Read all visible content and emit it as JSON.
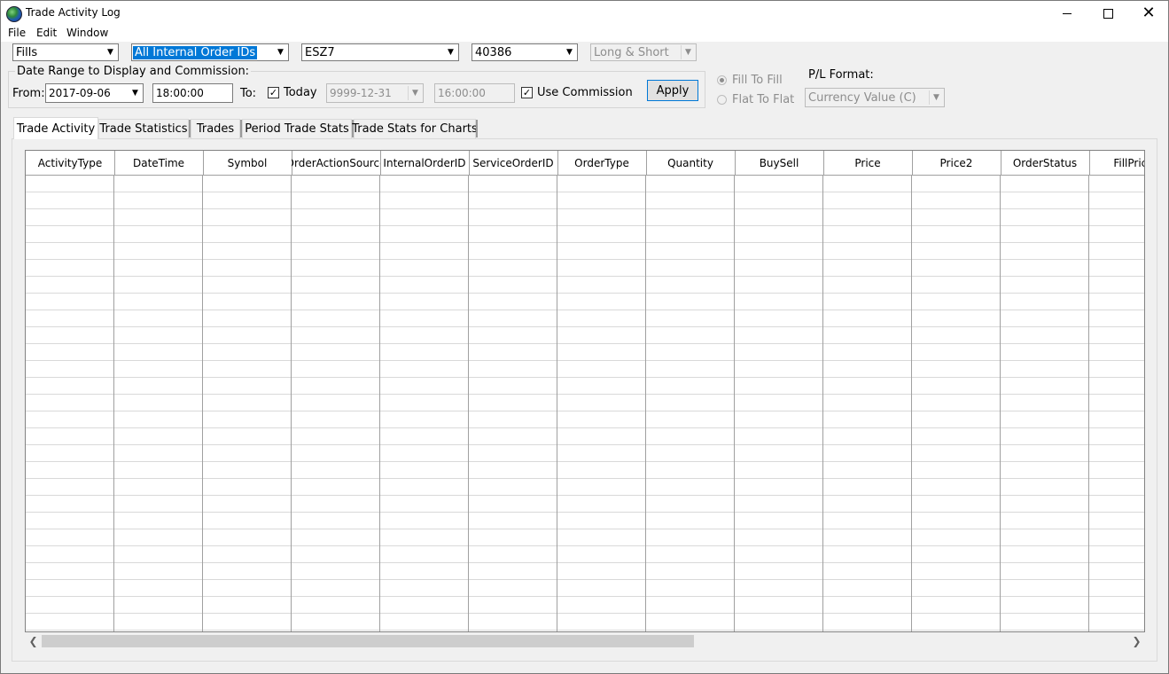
{
  "window": {
    "title": "Trade Activity Log"
  },
  "menu": [
    "File",
    "Edit",
    "Window"
  ],
  "toolbar": {
    "view_select": "Fills",
    "order_ids_select": "All Internal Order IDs",
    "symbol_select": "ESZ7",
    "account_select": "40386",
    "direction_select": "Long & Short"
  },
  "date_range": {
    "legend": "Date Range to Display and Commission:",
    "from_label": "From:",
    "from_date": "2017-09-06",
    "from_time": "18:00:00",
    "to_label": "To:",
    "today_checked": true,
    "today_label": "Today",
    "to_date": "9999-12-31",
    "to_time": "16:00:00",
    "use_commission_checked": true,
    "use_commission_label": "Use Commission",
    "apply_label": "Apply"
  },
  "pl_options": {
    "fill_to_fill_label": "Fill To Fill",
    "flat_to_flat_label": "Flat To Flat",
    "pl_format_label": "P/L Format:",
    "pl_format_value": "Currency Value (C)"
  },
  "tabs": [
    "Trade Activity",
    "Trade Statistics",
    "Trades",
    "Period Trade Stats",
    "Trade Stats for Charts"
  ],
  "grid": {
    "columns": [
      "ActivityType",
      "DateTime",
      "Symbol",
      "OrderActionSource",
      "InternalOrderID",
      "ServiceOrderID",
      "OrderType",
      "Quantity",
      "BuySell",
      "Price",
      "Price2",
      "OrderStatus",
      "FillPrice"
    ],
    "rows": []
  },
  "icons": {
    "app": "globe-icon",
    "minimize": "minimize-icon",
    "maximize": "maximize-icon",
    "close": "close-icon",
    "dropdown": "chevron-down-icon",
    "scroll_left": "chevron-left-icon",
    "scroll_right": "chevron-right-icon"
  },
  "colors": {
    "selection": "#0078d7",
    "disabled_text": "#8d8d8d",
    "button_border": "#0078d7"
  }
}
